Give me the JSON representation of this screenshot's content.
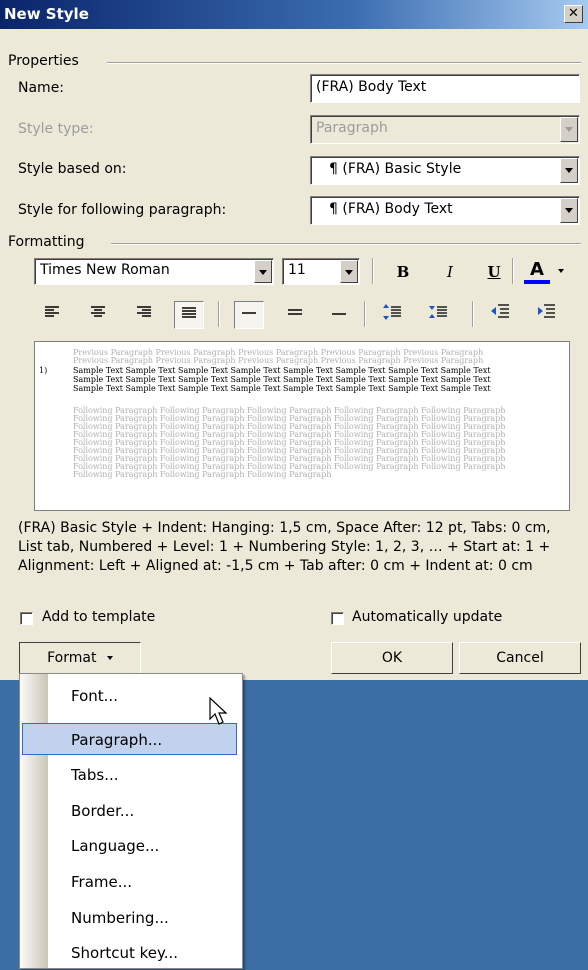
{
  "dialog": {
    "title": "New Style"
  },
  "properties": {
    "section_label": "Properties",
    "name_label": "Name:",
    "name_value": "(FRA) Body Text",
    "style_type_label": "Style type:",
    "style_type_value": "Paragraph",
    "based_on_label": "Style based on:",
    "based_on_value": "¶ (FRA) Basic Style",
    "following_label": "Style for following paragraph:",
    "following_value": "¶ (FRA) Body Text"
  },
  "formatting": {
    "section_label": "Formatting",
    "font_name": "Times New Roman",
    "font_size": "11",
    "bold": "B",
    "italic": "I",
    "underline": "U",
    "font_color": "A"
  },
  "preview": {
    "previous": "Previous Paragraph Previous Paragraph Previous Paragraph Previous Paragraph Previous Paragraph",
    "previous2": "Previous Paragraph Previous Paragraph Previous Paragraph Previous Paragraph Previous Paragraph",
    "number": "1)",
    "sample1": "Sample Text Sample Text Sample Text Sample Text Sample Text Sample Text Sample Text Sample Text",
    "sample2": "Sample Text Sample Text Sample Text Sample Text Sample Text Sample Text Sample Text Sample Text",
    "sample3": "Sample Text Sample Text Sample Text Sample Text Sample Text Sample Text Sample Text Sample Text",
    "following": "Following Paragraph Following Paragraph Following Paragraph Following Paragraph Following Paragraph",
    "following_last": "Following Paragraph Following Paragraph Following Paragraph"
  },
  "description": "(FRA) Basic Style + Indent: Hanging:  1,5 cm, Space After:  12 pt, Tabs:  0 cm, List tab, Numbered + Level: 1 + Numbering Style: 1, 2, 3, … + Start at: 1 + Alignment: Left + Aligned at:  -1,5 cm + Tab after:  0 cm + Indent at:  0 cm",
  "options": {
    "add_to_template": "Add to template",
    "auto_update": "Automatically update"
  },
  "buttons": {
    "format": "Format",
    "ok": "OK",
    "cancel": "Cancel"
  },
  "format_menu": {
    "items": [
      "Font...",
      "Paragraph...",
      "Tabs...",
      "Border...",
      "Language...",
      "Frame...",
      "Numbering...",
      "Shortcut key..."
    ],
    "highlighted": "Paragraph..."
  },
  "colors": {
    "title_bar": "#0a246a",
    "desktop": "#3a6ea5",
    "menu_highlight": "#c1d2ee",
    "font_color_bar": "#0000ff"
  },
  "icons": [
    "close-icon",
    "align-left-icon",
    "align-center-icon",
    "align-right-icon",
    "justify-icon",
    "single-spacing-icon",
    "one-half-spacing-icon",
    "double-spacing-icon",
    "increase-spacing-icon",
    "decrease-spacing-icon",
    "decrease-indent-icon",
    "increase-indent-icon",
    "mouse-pointer-icon"
  ]
}
